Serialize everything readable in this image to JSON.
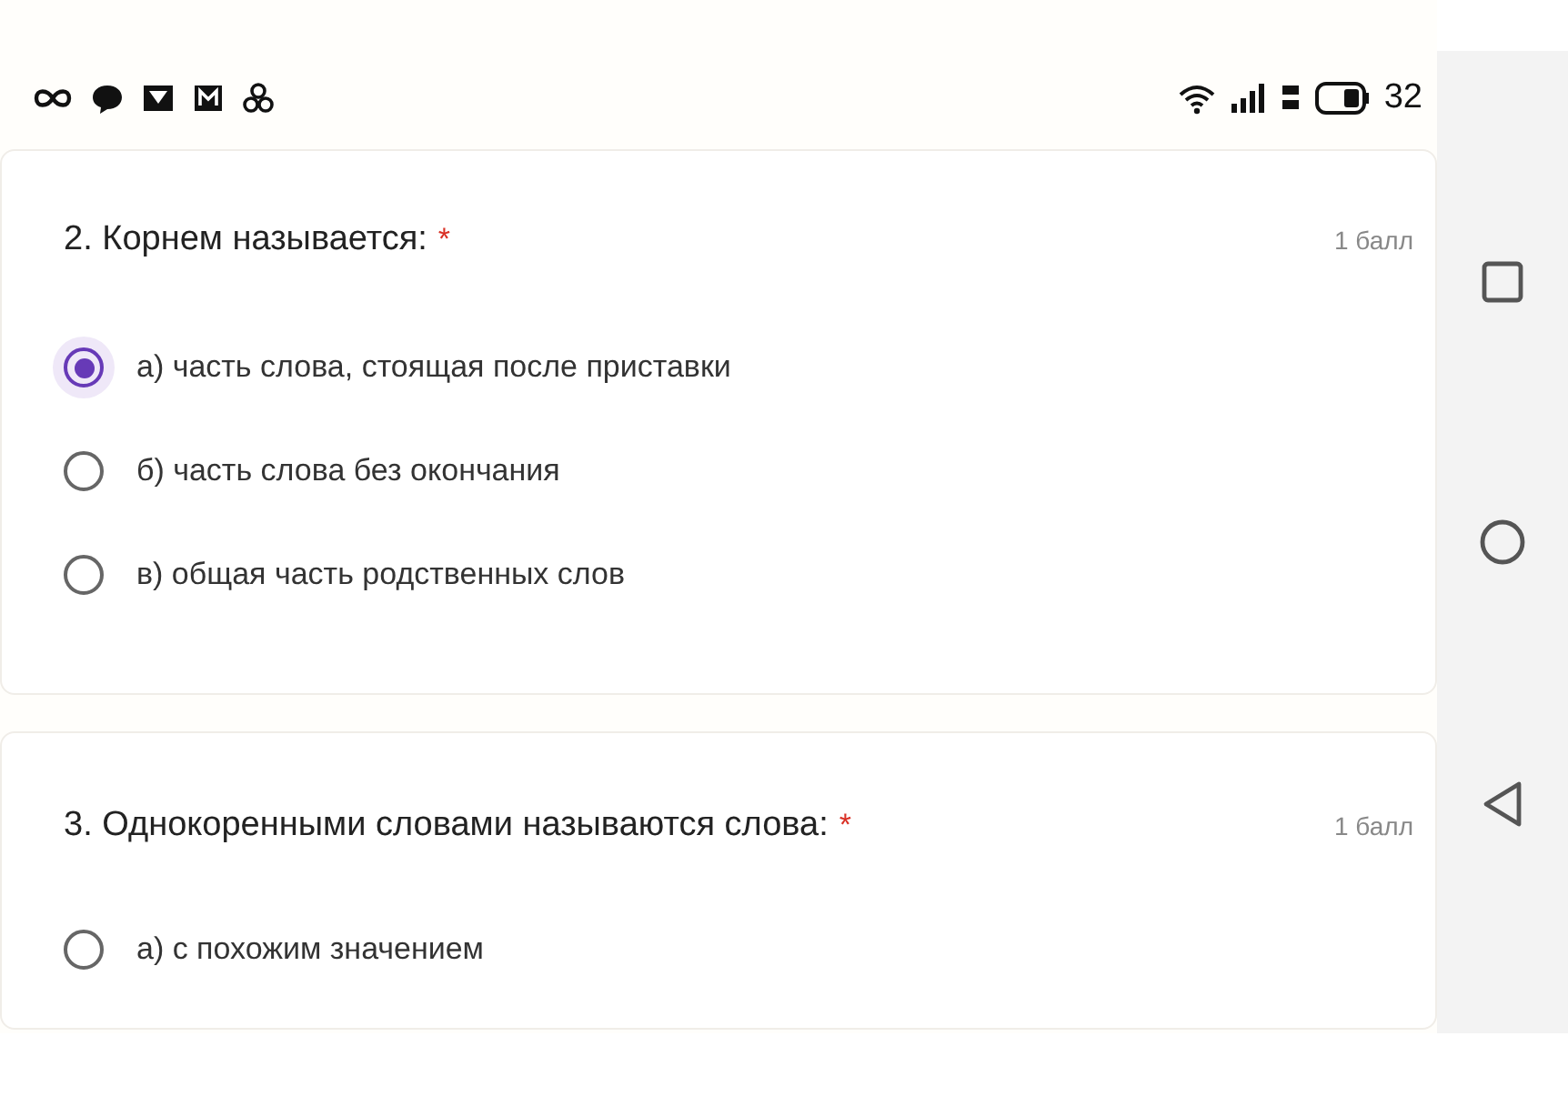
{
  "status_bar": {
    "battery_text": "32"
  },
  "questions": [
    {
      "title": "2. Корнем называется:",
      "required_mark": "*",
      "points": "1 балл",
      "options": [
        {
          "label": "а) часть слова, стоящая после приставки",
          "selected": true
        },
        {
          "label": "б) часть слова без окончания",
          "selected": false
        },
        {
          "label": "в) общая часть родственных слов",
          "selected": false
        }
      ]
    },
    {
      "title": "3. Однокоренными словами называются слова:",
      "required_mark": "*",
      "points": "1 балл",
      "options": [
        {
          "label": "а) с похожим значением",
          "selected": false
        }
      ]
    }
  ]
}
